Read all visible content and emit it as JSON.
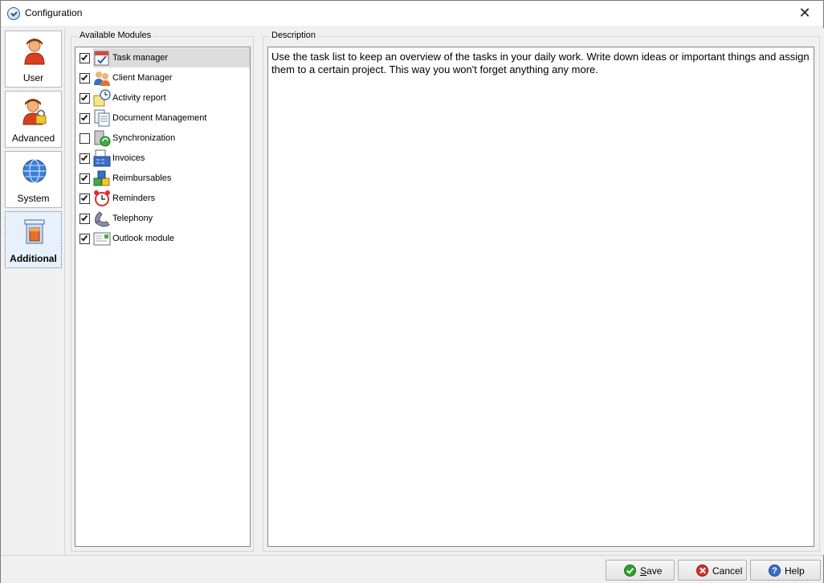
{
  "window": {
    "title": "Configuration",
    "close_icon": "close-icon"
  },
  "nav": {
    "items": [
      {
        "label": "User",
        "icon": "user-icon",
        "active": false
      },
      {
        "label": "Advanced",
        "icon": "user-lock-icon",
        "active": false
      },
      {
        "label": "System",
        "icon": "globe-icon",
        "active": false
      },
      {
        "label": "Additional",
        "icon": "additional-icon",
        "active": true
      }
    ]
  },
  "modules": {
    "legend": "Available Modules",
    "items": [
      {
        "label": "Task manager",
        "checked": true,
        "icon": "task-manager-icon",
        "selected": true
      },
      {
        "label": "Client Manager",
        "checked": true,
        "icon": "client-manager-icon",
        "selected": false
      },
      {
        "label": "Activity report",
        "checked": true,
        "icon": "activity-report-icon",
        "selected": false
      },
      {
        "label": "Document Management",
        "checked": true,
        "icon": "document-management-icon",
        "selected": false
      },
      {
        "label": "Synchronization",
        "checked": false,
        "icon": "synchronization-icon",
        "selected": false
      },
      {
        "label": "Invoices",
        "checked": true,
        "icon": "invoices-icon",
        "selected": false
      },
      {
        "label": "Reimbursables",
        "checked": true,
        "icon": "reimbursables-icon",
        "selected": false
      },
      {
        "label": "Reminders",
        "checked": true,
        "icon": "reminders-icon",
        "selected": false
      },
      {
        "label": "Telephony",
        "checked": true,
        "icon": "telephony-icon",
        "selected": false
      },
      {
        "label": "Outlook module",
        "checked": true,
        "icon": "outlook-module-icon",
        "selected": false
      }
    ]
  },
  "description": {
    "legend": "Description",
    "text": "Use the task list to keep an overview of the tasks in your daily work. Write down ideas or important things and assign them to a certain project. This way you won't forget anything any more."
  },
  "buttons": {
    "save": {
      "mnemonic": "S",
      "rest": "ave",
      "icon": "check-icon"
    },
    "cancel": {
      "label": "Cancel",
      "icon": "cancel-icon"
    },
    "help": {
      "label": "Help",
      "icon": "help-icon",
      "glyph": "?"
    }
  }
}
